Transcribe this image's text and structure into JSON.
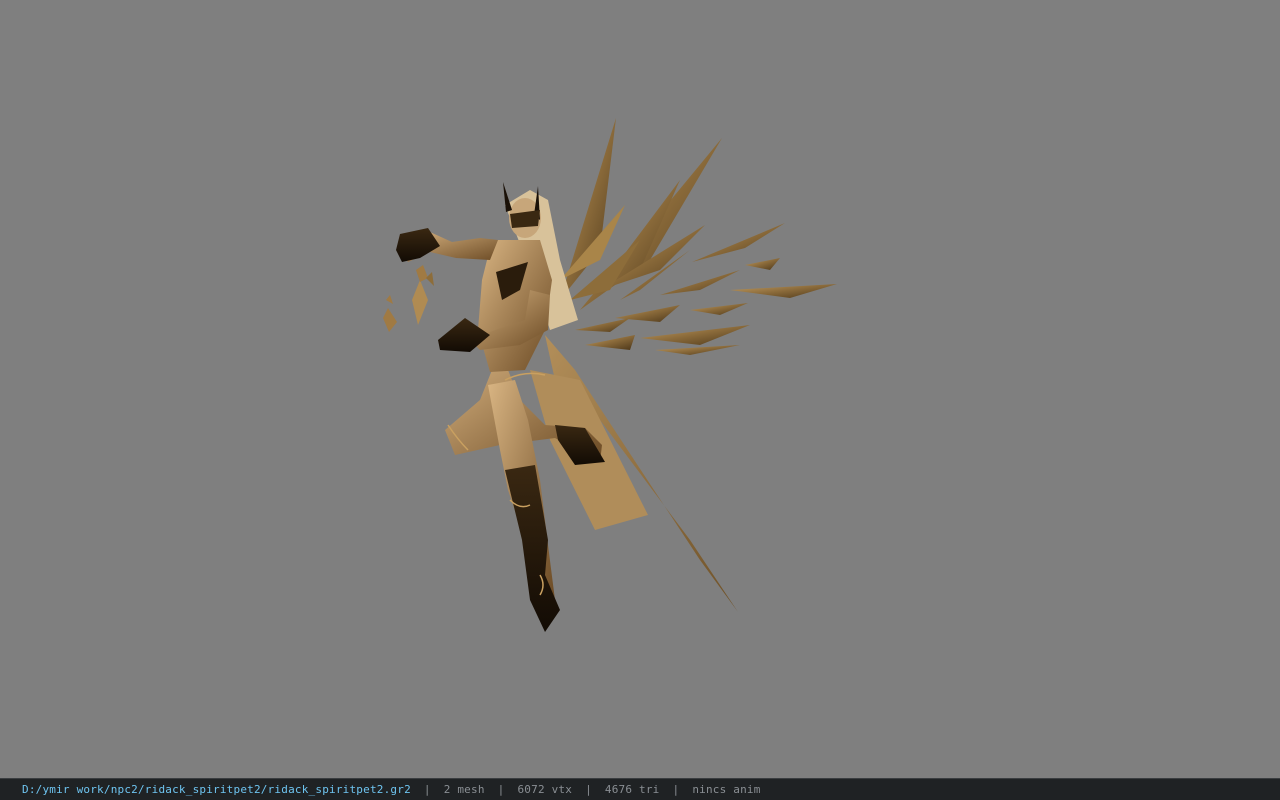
{
  "viewport": {
    "background": "#7f7f7f",
    "model_description_icon": "winged-spirit-character-model"
  },
  "status_bar": {
    "file_path": "D:/ymir work/npc2/ridack_spiritpet2/ridack_spiritpet2.gr2",
    "separator": "|",
    "mesh": "2 mesh",
    "vertices": "6072 vtx",
    "triangles": "4676 tri",
    "animation": "nincs anim",
    "path_color": "#6ec4f0",
    "text_color": "#8a8f94"
  }
}
